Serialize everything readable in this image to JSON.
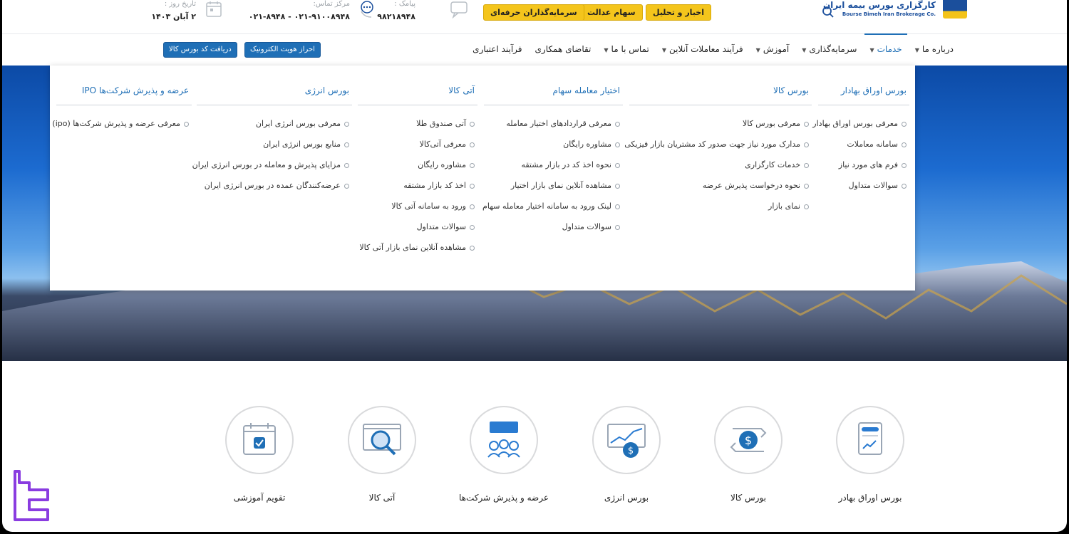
{
  "brand": {
    "name_fa": "کارگزاری بورس بیمه ایران",
    "name_en": "Bourse Bimeh Iran Brokerage Co.",
    "colors": {
      "primary": "#1f6fb6",
      "accent": "#f4c51c"
    }
  },
  "header": {
    "search_icon": "search-icon",
    "top_buttons": [
      "اخبار و تحلیل",
      "سهام عدالت",
      "سرمایه‌گذاران حرفه‌ای"
    ],
    "sms": {
      "label": "پیامک :",
      "value": "۹۸۲۱۸۹۴۸"
    },
    "call_center": {
      "label": "مرکز تماس:",
      "value": "۰۲۱-۹۱۰۰۸۹۴۸ - ۰۲۱-۸۹۴۸"
    },
    "date": {
      "label": "تاریخ روز :",
      "value": "۲ آبان ۱۴۰۳"
    }
  },
  "nav": {
    "items": [
      {
        "label": "درباره ما",
        "has_dropdown": true
      },
      {
        "label": "خدمات",
        "has_dropdown": true,
        "active": true
      },
      {
        "label": "سرمایه‌گذاری",
        "has_dropdown": true
      },
      {
        "label": "آموزش",
        "has_dropdown": true
      },
      {
        "label": "فرآیند معاملات آنلاین",
        "has_dropdown": true
      },
      {
        "label": "تماس با ما",
        "has_dropdown": true
      },
      {
        "label": "تقاضای همکاری",
        "has_dropdown": false
      },
      {
        "label": "فرآیند اعتباری",
        "has_dropdown": false
      }
    ],
    "buttons": [
      "احراز هویت الکترونیک",
      "دریافت کد بورس کالا"
    ]
  },
  "mega_menu": {
    "columns": [
      {
        "title": "بورس اوراق بهادار",
        "items": [
          "معرفی بورس اوراق بهادار",
          "سامانه معاملات",
          "فرم های مورد نیاز",
          "سوالات متداول"
        ]
      },
      {
        "title": "بورس کالا",
        "items": [
          "معرفی بورس کالا",
          "مدارک مورد نیاز جهت صدور کد مشتریان بازار فیزیکی",
          "خدمات کارگزاری",
          "نحوه درخواست پذیرش عرضه",
          "نمای بازار"
        ]
      },
      {
        "title": "اختیار معامله سهام",
        "items": [
          "معرفی قراردادهای اختیار معامله",
          "مشاوره رایگان",
          "نحوه اخذ کد در بازار مشتقه",
          "مشاهده آنلاین نمای بازار اختیار",
          "لینک ورود به سامانه اختیار معامله سهام",
          "سوالات متداول"
        ]
      },
      {
        "title": "آتی کالا",
        "items": [
          "آتی صندوق طلا",
          "معرفی آتی‌کالا",
          "مشاوره رایگان",
          "اخذ کد بازار مشتقه",
          "ورود به سامانه آتی کالا",
          "سوالات متداول",
          "مشاهده آنلاین نمای بازار آتی کالا"
        ]
      },
      {
        "title": "بورس انرژی",
        "items": [
          "معرفی بورس انرژی ایران",
          "منابع بورس انرژی ایران",
          "مزایای پذیرش و معامله در بورس انرژی ایران",
          "عرضه‌کنندگان عمده در بورس انرژی ایران"
        ]
      },
      {
        "title": "عرضه و پذیرش شرکت‌ها IPO",
        "items": [
          "معرفی عرضه و پذیرش شرکت‌ها (ipo)"
        ]
      }
    ]
  },
  "services": [
    {
      "label": "بورس اوراق بهادر",
      "icon": "document-chart-icon"
    },
    {
      "label": "بورس کالا",
      "icon": "dollar-exchange-icon"
    },
    {
      "label": "بورس انرژی",
      "icon": "chart-dollar-icon"
    },
    {
      "label": "عرضه و پذیرش شرکت‌ها",
      "icon": "people-chat-icon"
    },
    {
      "label": "آتی کالا",
      "icon": "magnifier-browser-icon"
    },
    {
      "label": "تقویم آموزشی",
      "icon": "calendar-check-icon"
    }
  ]
}
